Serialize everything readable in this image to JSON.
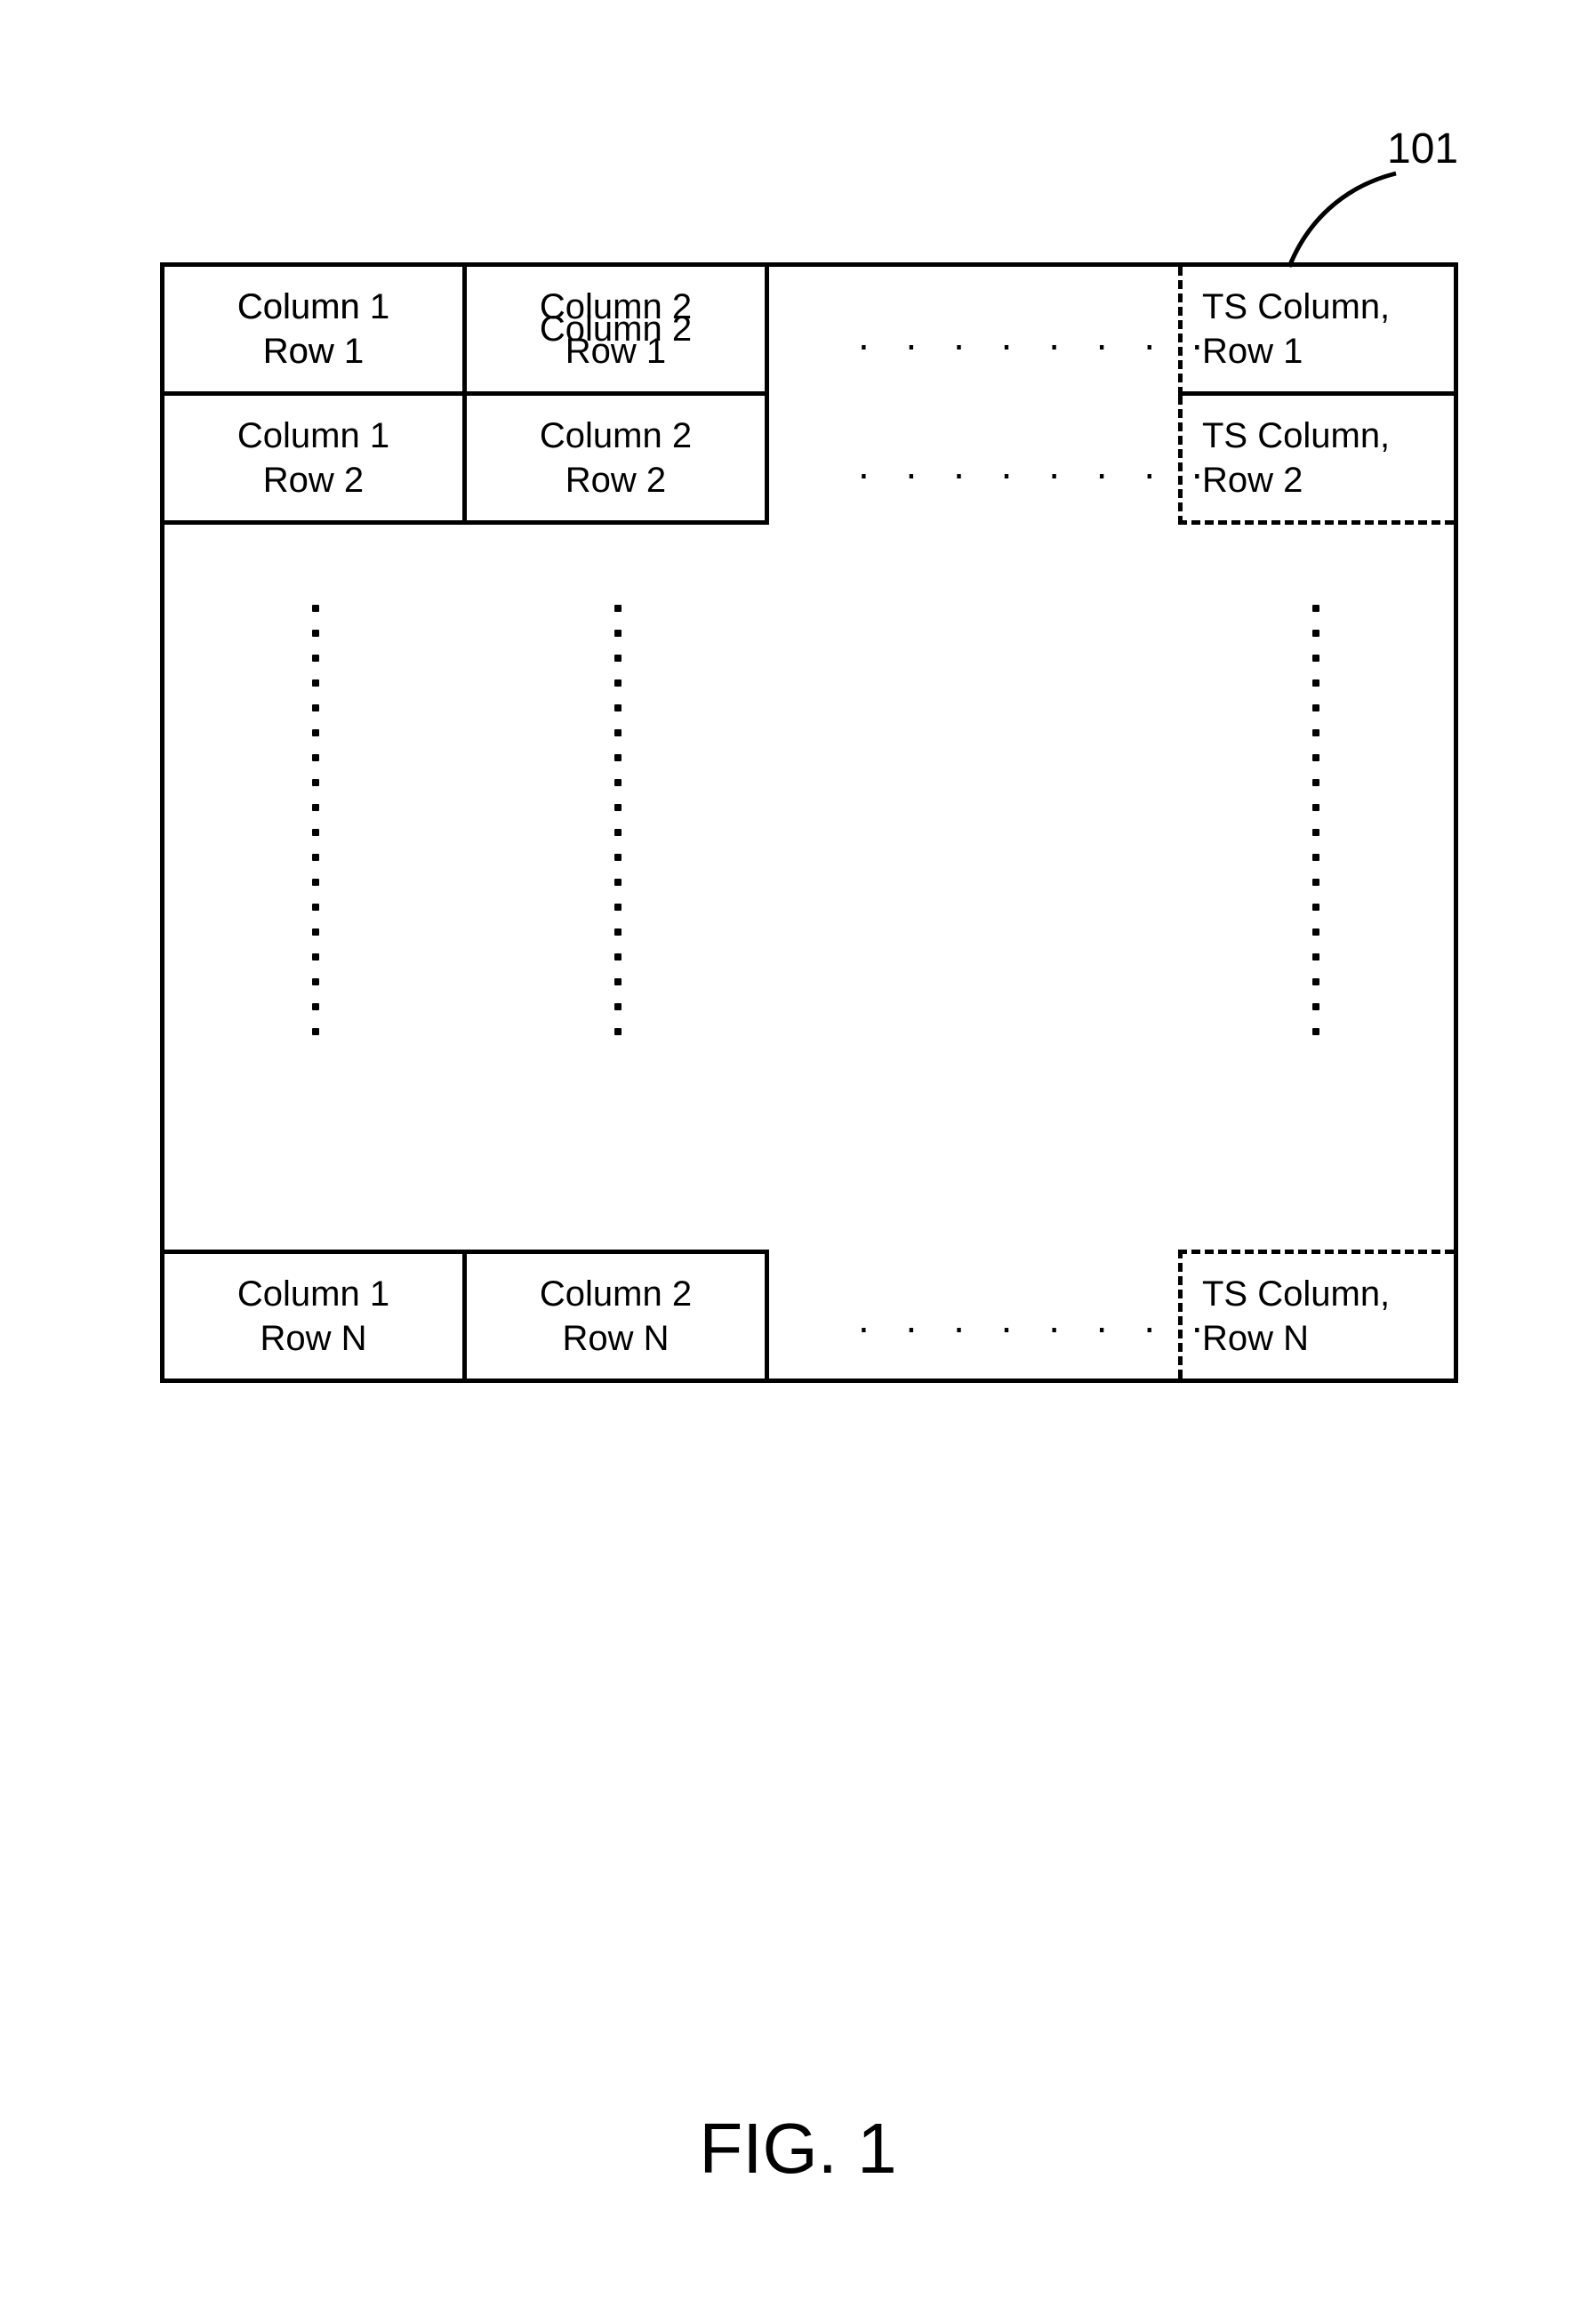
{
  "figure": {
    "caption": "FIG. 1",
    "callout": "101"
  },
  "grid": {
    "rows": [
      {
        "c1": {
          "l1": "Column 1",
          "l2": "Row 1"
        },
        "c2": {
          "l1": "Column 2",
          "l2": "Row 1"
        },
        "ts": {
          "l1": "TS Column,",
          "l2": "Row 1"
        }
      },
      {
        "c1": {
          "l1": "Column 1",
          "l2": "Row 2"
        },
        "c2": {
          "l1": "Column 2",
          "l2": "Row 2"
        },
        "ts": {
          "l1": "TS Column,",
          "l2": "Row 2"
        }
      },
      {
        "c1": {
          "l1": "Column 1",
          "l2": "Row N"
        },
        "c2": {
          "l1": "Column 2",
          "l2": "Row N"
        },
        "ts": {
          "l1": "TS Column,",
          "l2": "Row N"
        }
      }
    ],
    "hdots": ". . . . . . . ."
  }
}
